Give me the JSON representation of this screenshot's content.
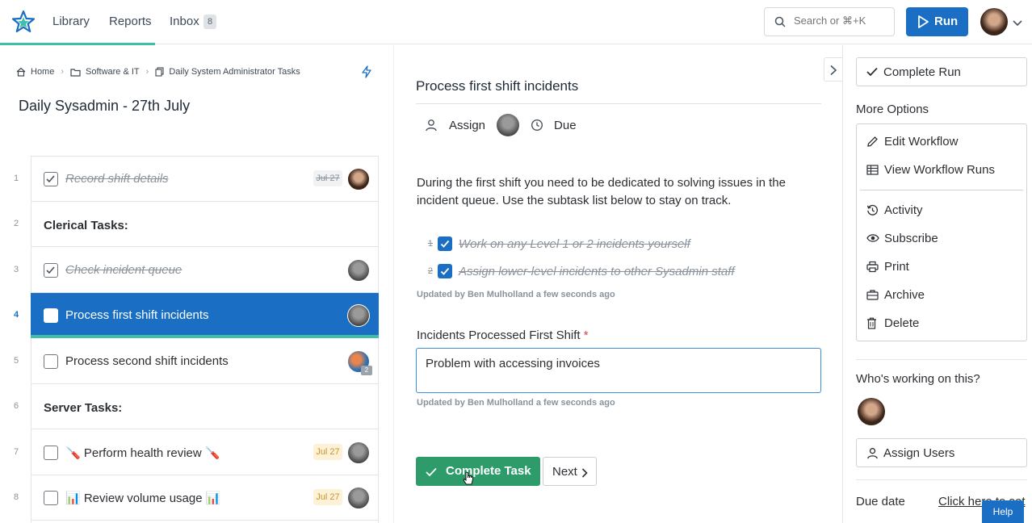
{
  "nav": {
    "items": [
      "Library",
      "Reports",
      "Inbox"
    ],
    "inbox_count": "8",
    "search_placeholder": "Search or ⌘+K",
    "run_label": "Run"
  },
  "breadcrumb": [
    "Home",
    "Software & IT",
    "Daily System Administrator Tasks"
  ],
  "run_title": "Daily Sysadmin - 27th July",
  "tasks": [
    {
      "num": "1",
      "label": "Record shift details",
      "due": "Jul 27"
    },
    {
      "num": "2",
      "label": "Clerical Tasks:"
    },
    {
      "num": "3",
      "label": "Check incident queue"
    },
    {
      "num": "4",
      "label": "Process first shift incidents"
    },
    {
      "num": "5",
      "label": "Process second shift incidents",
      "assignee_count": "2"
    },
    {
      "num": "6",
      "label": "Server Tasks:"
    },
    {
      "num": "7",
      "label": "🪛 Perform health review 🪛",
      "due": "Jul 27"
    },
    {
      "num": "8",
      "label": "📊 Review volume usage 📊",
      "due": "Jul 27"
    }
  ],
  "task_detail": {
    "title": "Process first shift incidents",
    "assign_label": "Assign",
    "due_label": "Due",
    "description": "During the first shift you need to be dedicated to solving issues in the incident queue. Use the subtask list below to stay on track.",
    "subtasks": [
      {
        "num": "1",
        "label": "Work on any Level 1 or 2 incidents yourself"
      },
      {
        "num": "2",
        "label": "Assign lower-level incidents to other Sysadmin staff"
      }
    ],
    "subtasks_updated": "Updated by Ben Mulholland a few seconds ago",
    "field_label": "Incidents Processed First Shift",
    "field_required": "*",
    "field_value": "Problem with accessing invoices",
    "field_updated": "Updated by Ben Mulholland a few seconds ago",
    "complete_label": "Complete Task",
    "next_label": "Next"
  },
  "sidebar": {
    "complete_run_label": "Complete Run",
    "more_options_label": "More Options",
    "options": [
      "Edit Workflow",
      "View Workflow Runs",
      "Activity",
      "Subscribe",
      "Print",
      "Archive",
      "Delete"
    ],
    "working_label": "Who's working on this?",
    "assign_users_label": "Assign Users",
    "due_date_label": "Due date",
    "due_date_link": "Click here to set"
  },
  "help_label": "Help",
  "colors": {
    "accent": "#1a6fc4",
    "success": "#2e9c6a",
    "teal": "#3fbfa6",
    "warning_bg": "#fdf2d8"
  }
}
